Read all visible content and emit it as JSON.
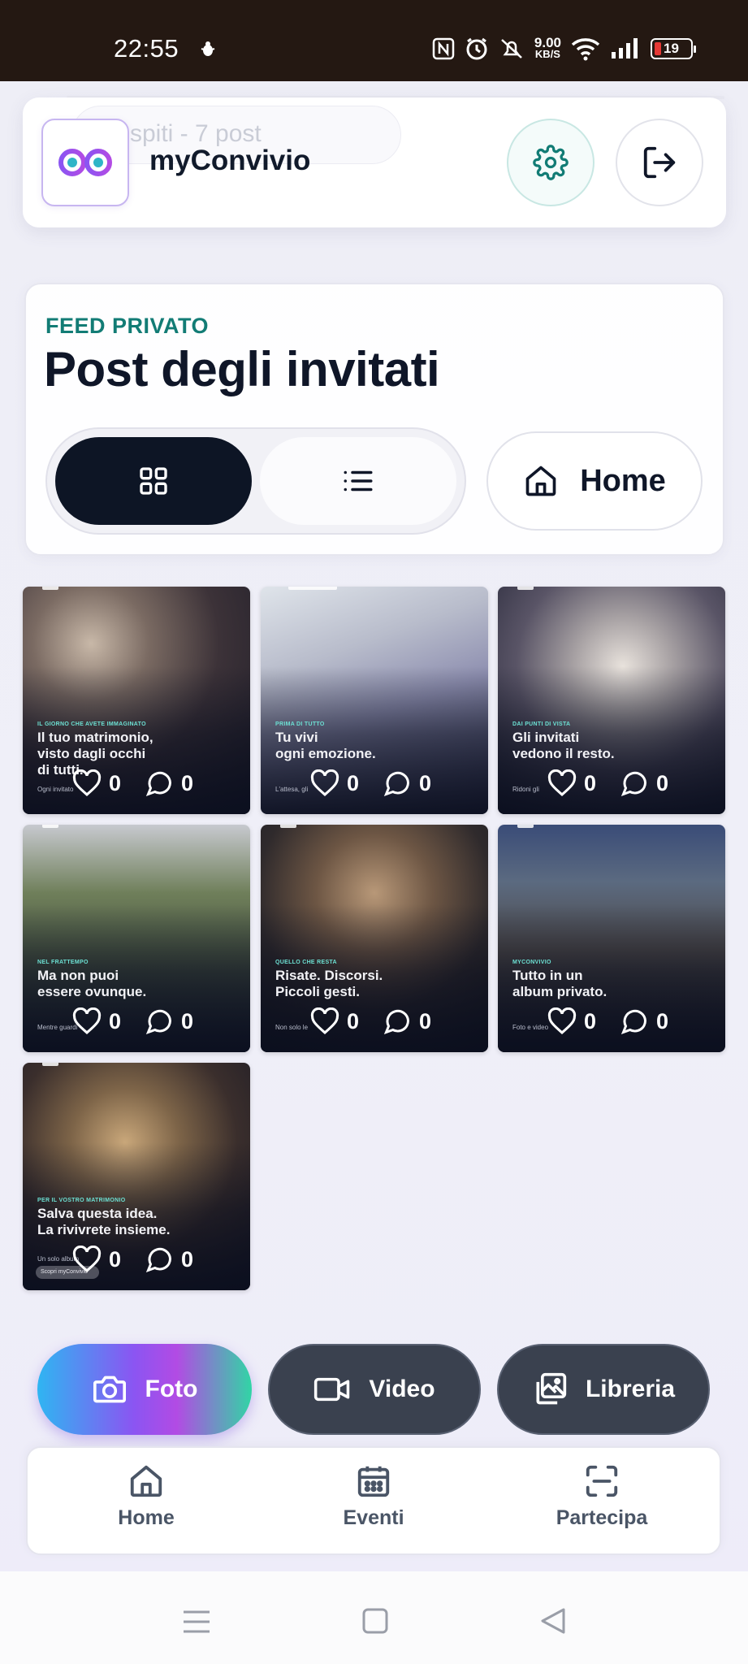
{
  "status_bar": {
    "time": "22:55",
    "speed_value": "9.00",
    "speed_unit": "KB/S",
    "battery": "19",
    "icons": [
      "bug-icon",
      "nfc-icon",
      "alarm-icon",
      "mute-icon",
      "wifi-icon",
      "signal-icon",
      "battery-icon"
    ]
  },
  "header": {
    "app_name": "myConvivio",
    "ghost_text": "spiti - 7 post",
    "logo_icon": "infinity-logo-icon",
    "settings_icon": "gear-icon",
    "logout_icon": "logout-icon"
  },
  "feed": {
    "kicker": "FEED PRIVATO",
    "title": "Post degli invitati",
    "home_label": "Home"
  },
  "posts": [
    {
      "tag": "IL GIORNO CHE AVETE IMMAGINATO",
      "caption": "Il tuo matrimonio,\nvisto dagli occhi\ndi tutti.",
      "sub": "Ogni invitato",
      "likes": "0",
      "comments": "0"
    },
    {
      "tag": "PRIMA DI TUTTO",
      "caption": "Tu vivi\nogni emozione.",
      "sub": "L'attesa, gli",
      "likes": "0",
      "comments": "0"
    },
    {
      "tag": "DAI PUNTI DI VISTA",
      "caption": "Gli invitati\nvedono il resto.",
      "sub": "Ridoni gli",
      "likes": "0",
      "comments": "0"
    },
    {
      "tag": "NEL FRATTEMPO",
      "caption": "Ma non puoi\nessere ovunque.",
      "sub": "Mentre guardi",
      "likes": "0",
      "comments": "0"
    },
    {
      "tag": "QUELLO CHE RESTA",
      "caption": "Risate. Discorsi.\nPiccoli gesti.",
      "sub": "Non solo le",
      "likes": "0",
      "comments": "0"
    },
    {
      "tag": "MYCONVIVIO",
      "caption": "Tutto in un\nalbum privato.",
      "sub": "Foto e video",
      "likes": "0",
      "comments": "0"
    },
    {
      "tag": "PER IL VOSTRO MATRIMONIO",
      "caption": "Salva questa idea.\nLa rivivrete insieme.",
      "sub": "Un solo album",
      "chip": "Scopri myConvivio",
      "likes": "0",
      "comments": "0"
    }
  ],
  "actions": {
    "foto": "Foto",
    "video": "Video",
    "libreria": "Libreria"
  },
  "nav": {
    "home": "Home",
    "eventi": "Eventi",
    "partecipa": "Partecipa"
  },
  "colors": {
    "accent_teal": "#127c75",
    "dark": "#0d1525",
    "action_dark": "#3a414f"
  }
}
